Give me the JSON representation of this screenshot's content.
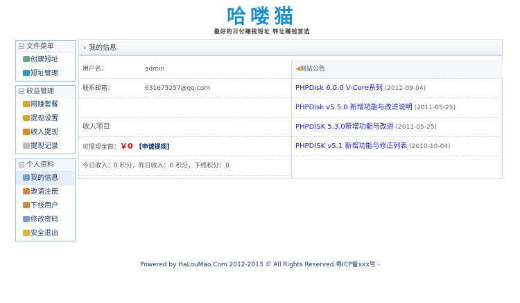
{
  "logo": {
    "title": "哈喽猫",
    "slogan": "最好的日付赚钱短址 转址赚钱首选"
  },
  "sidebar": [
    {
      "title": "文件菜单",
      "items": [
        {
          "label": "创建短址",
          "icon": "link-icon"
        },
        {
          "label": "短址管理",
          "icon": "home-icon"
        }
      ]
    },
    {
      "title": "收益管理",
      "items": [
        {
          "label": "网赚套餐",
          "icon": "pencil-icon"
        },
        {
          "label": "提现设置",
          "icon": "pencil-icon"
        },
        {
          "label": "收入提现",
          "icon": "user-money-icon"
        },
        {
          "label": "提现记录",
          "icon": "document-icon"
        }
      ]
    },
    {
      "title": "个人资料",
      "items": [
        {
          "label": "我的信息",
          "icon": "table-icon"
        },
        {
          "label": "邀请注册",
          "icon": "users-icon"
        },
        {
          "label": "下线用户",
          "icon": "users-icon"
        },
        {
          "label": "修改密码",
          "icon": "table-icon"
        },
        {
          "label": "安全退出",
          "icon": "key-icon"
        }
      ]
    }
  ],
  "main": {
    "title": "我的信息",
    "username_label": "用户名：",
    "username": "admin",
    "email_label": "联系邮箱：",
    "email": "631675257@qq.com",
    "income_title": "收入项目",
    "withdraw_label": "可提现金额：",
    "withdraw_amount": "￥0",
    "apply_label": "【申请提现】",
    "stats": "今日收入：0 积分，昨日收入：0 积分，下线积分：0"
  },
  "notice": {
    "title": "网站公告",
    "items": [
      {
        "title": "PHPDisk 6.0.0 V-Core系列",
        "date": "(2012-09-04)"
      },
      {
        "title": "PHPDisk v5.5.0 新增功能与改进说明",
        "date": "(2011-05-25)"
      },
      {
        "title": "PHPDISK 5.3.0新增功能与改进",
        "date": "(2011-05-25)"
      },
      {
        "title": "PHPDISK v5.1 新增功能与修正列表",
        "date": "(2010-10-04)"
      }
    ]
  },
  "footer": "Powered by HaLouMao.Com 2012-2013 © All Rights Reserved.粤ICP备xxx号 -"
}
